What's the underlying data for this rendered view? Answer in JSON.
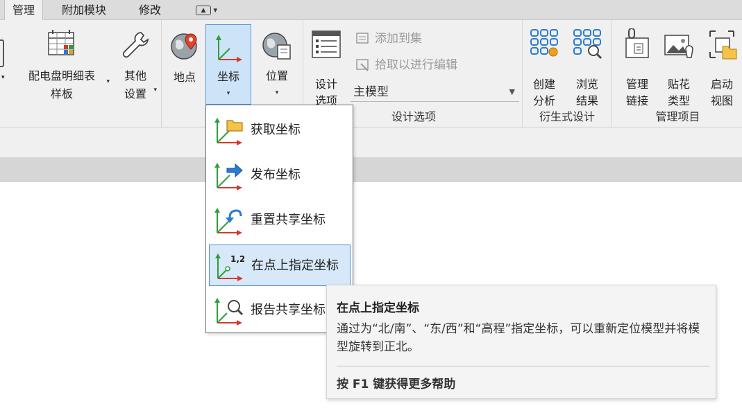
{
  "tabs": [
    {
      "label": "管理",
      "active": true
    },
    {
      "label": "附加模块",
      "active": false
    },
    {
      "label": "修改",
      "active": false
    }
  ],
  "ribbon": {
    "buttons": {
      "panel_schedule": {
        "line1": "配电盘明细表",
        "line2": "样板"
      },
      "other_settings": {
        "line1": "其他",
        "line2": "设置"
      },
      "location": {
        "label": "地点"
      },
      "coordinates": {
        "label": "坐标"
      },
      "position": {
        "label": "位置"
      },
      "design_options": {
        "line1": "设计",
        "line2": "选项"
      },
      "create_analysis": {
        "line1": "创建",
        "line2": "分析"
      },
      "browse_results": {
        "line1": "浏览",
        "line2": "结果"
      },
      "manage_links": {
        "line1": "管理",
        "line2": "链接"
      },
      "decal_types": {
        "line1": "贴花",
        "line2": "类型"
      },
      "starting_view": {
        "line1": "启动",
        "line2": "视图"
      }
    },
    "small_commands": {
      "add_to_set": "添加到集",
      "pick_to_edit": "拾取以进行编辑"
    },
    "combo_value": "主模型",
    "panels": {
      "design_options": "设计选项",
      "generative_design": "衍生式设计",
      "manage_project": "管理项目"
    }
  },
  "menu": {
    "items": [
      {
        "label": "获取坐标"
      },
      {
        "label": "发布坐标"
      },
      {
        "label": "重置共享坐标"
      },
      {
        "label": "在点上指定坐标",
        "icon_text": "1,2"
      },
      {
        "label": "报告共享坐标"
      }
    ]
  },
  "tooltip": {
    "title": "在点上指定坐标",
    "description": "通过为“北/南”、“东/西”和“高程”指定坐标，可以重新定位模型并将模型旋转到正北。",
    "help": "按 F1 键获得更多帮助"
  },
  "colors": {
    "accent_blue": "#2a7bd4",
    "axis_green": "#2e9e3a",
    "axis_red": "#d23a2e",
    "highlight": "#d7e8f8"
  }
}
